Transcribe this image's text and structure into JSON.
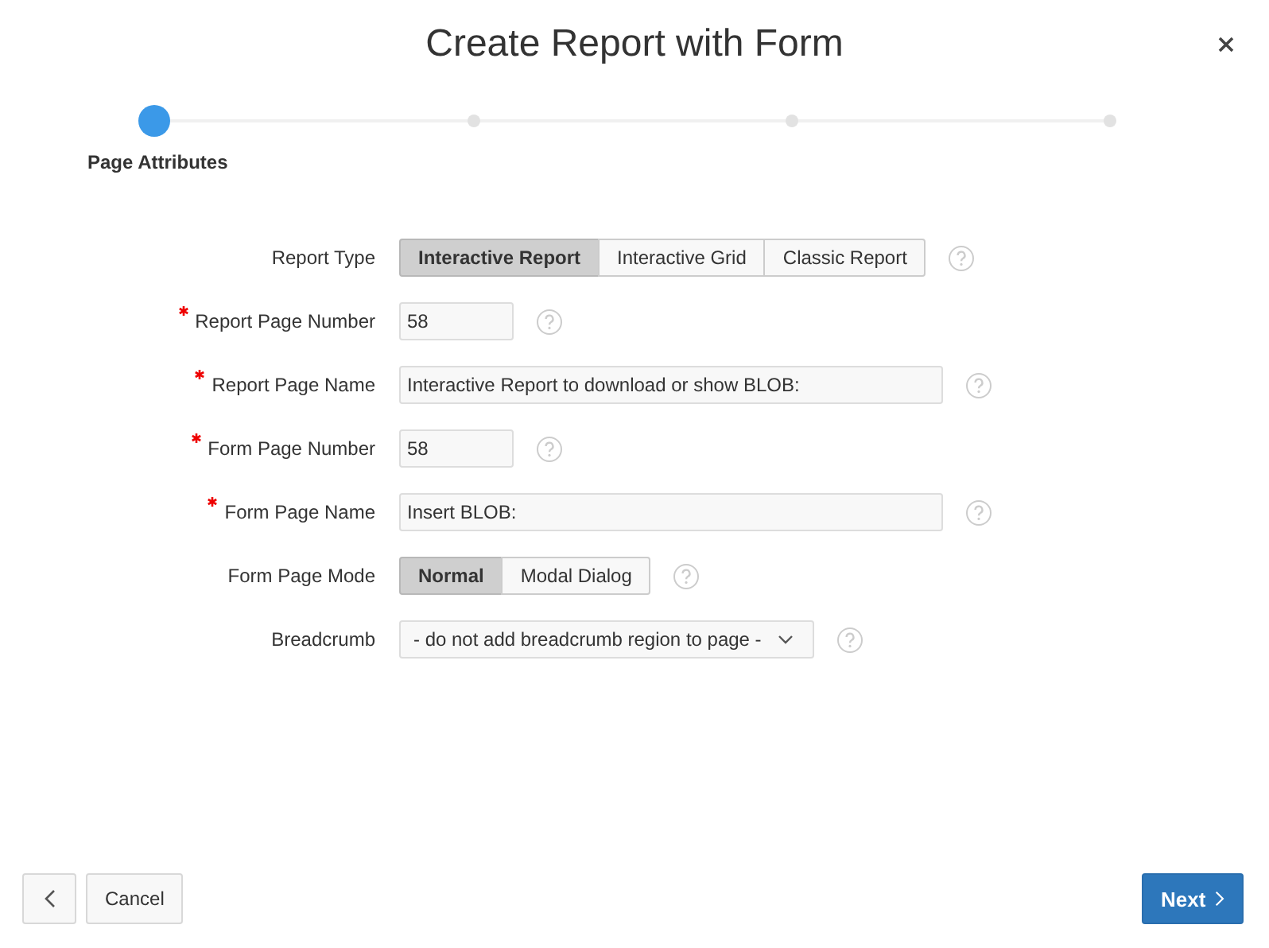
{
  "dialog": {
    "title": "Create Report with Form"
  },
  "steps": [
    {
      "label": "Page Attributes",
      "selected": true
    },
    {
      "selected": false
    },
    {
      "selected": false
    },
    {
      "selected": false
    }
  ],
  "fields": [
    {
      "kind": "toggle",
      "label": "Report Type",
      "required": false,
      "options": [
        {
          "label": "Interactive Report",
          "selected": true
        },
        {
          "label": "Interactive Grid",
          "selected": false
        },
        {
          "label": "Classic Report",
          "selected": false
        }
      ]
    },
    {
      "kind": "number",
      "label": "Report Page Number",
      "required": true,
      "value": "58"
    },
    {
      "kind": "text",
      "label": "Report Page Name",
      "required": true,
      "value": "Interactive Report to download or show BLOB:"
    },
    {
      "kind": "number",
      "label": "Form Page Number",
      "required": true,
      "value": "58"
    },
    {
      "kind": "text",
      "label": "Form Page Name",
      "required": true,
      "value": "Insert BLOB:"
    },
    {
      "kind": "toggle",
      "label": "Form Page Mode",
      "required": false,
      "options": [
        {
          "label": "Normal",
          "selected": true
        },
        {
          "label": "Modal Dialog",
          "selected": false
        }
      ]
    },
    {
      "kind": "select",
      "label": "Breadcrumb",
      "required": false,
      "value": "- do not add breadcrumb region to page -"
    }
  ],
  "footer": {
    "cancel": "Cancel",
    "next": "Next"
  }
}
